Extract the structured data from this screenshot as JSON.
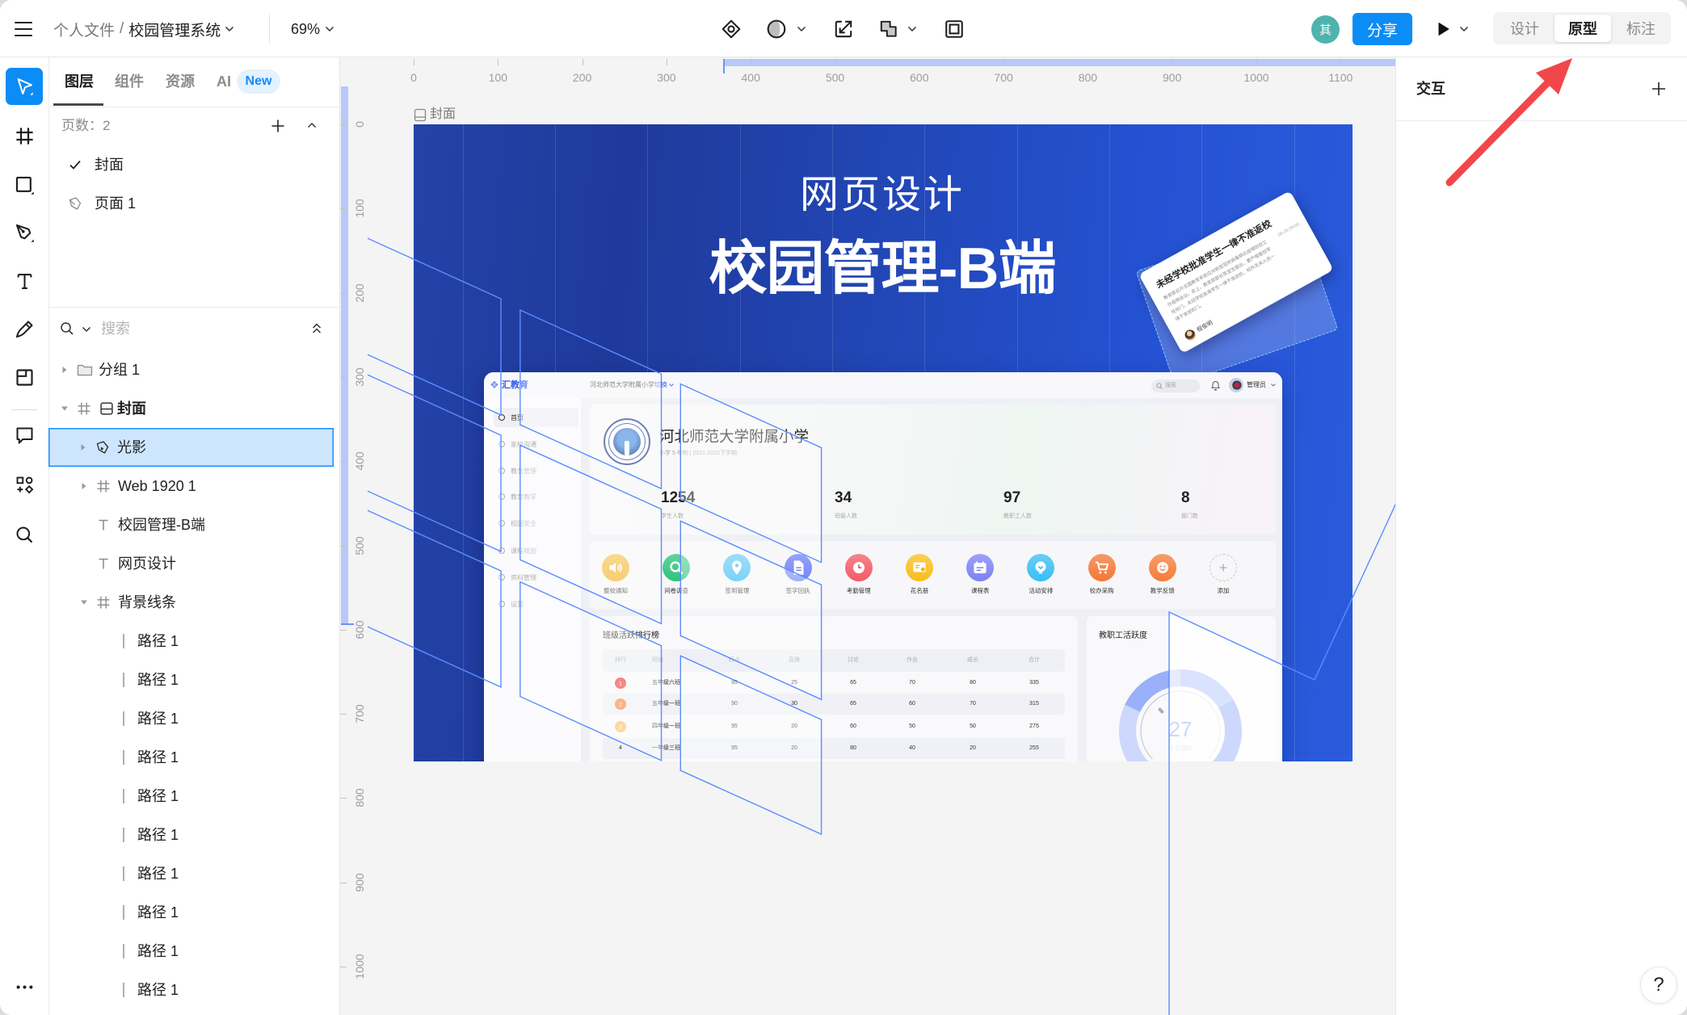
{
  "topbar": {
    "breadcrumb_parent": "个人文件",
    "breadcrumb_sep": "/",
    "file_name": "校园管理系统",
    "zoom": "69%",
    "center_tools": [
      "component-icon",
      "theme-icon",
      "export-icon",
      "boolean-icon",
      "frame-icon"
    ],
    "collaborator_initial": "其",
    "share_label": "分享",
    "modes": [
      {
        "label": "设计",
        "active": false
      },
      {
        "label": "原型",
        "active": true
      },
      {
        "label": "标注",
        "active": false
      }
    ]
  },
  "toolbar": {
    "tools": [
      "move",
      "frame",
      "rectangle",
      "pen",
      "text",
      "pencil",
      "section",
      "comment",
      "plugins",
      "search",
      "more"
    ],
    "active": "move"
  },
  "layers_panel": {
    "tabs": [
      {
        "label": "图层",
        "active": true
      },
      {
        "label": "组件",
        "active": false
      },
      {
        "label": "资源",
        "active": false
      },
      {
        "label": "AI",
        "active": false,
        "badge": "New"
      }
    ],
    "pages_title": "页数：2",
    "pages": [
      {
        "label": "封面",
        "current": true
      },
      {
        "label": "页面 1",
        "current": false
      }
    ],
    "search_placeholder": "搜索",
    "tree": [
      {
        "label": "分组 1",
        "type": "group",
        "depth": 0,
        "expand": "collapsed"
      },
      {
        "label": "封面",
        "type": "frame-page",
        "depth": 0,
        "expand": "expanded",
        "bold": true
      },
      {
        "label": "光影",
        "type": "vector",
        "depth": 1,
        "expand": "collapsed",
        "selected": true
      },
      {
        "label": "Web 1920 1",
        "type": "frame",
        "depth": 1,
        "expand": "collapsed"
      },
      {
        "label": "校园管理-B端",
        "type": "text",
        "depth": 1
      },
      {
        "label": "网页设计",
        "type": "text",
        "depth": 1
      },
      {
        "label": "背景线条",
        "type": "frame",
        "depth": 1,
        "expand": "expanded"
      },
      {
        "label": "路径 1",
        "type": "line",
        "depth": 2
      },
      {
        "label": "路径 1",
        "type": "line",
        "depth": 2
      },
      {
        "label": "路径 1",
        "type": "line",
        "depth": 2
      },
      {
        "label": "路径 1",
        "type": "line",
        "depth": 2
      },
      {
        "label": "路径 1",
        "type": "line",
        "depth": 2
      },
      {
        "label": "路径 1",
        "type": "line",
        "depth": 2
      },
      {
        "label": "路径 1",
        "type": "line",
        "depth": 2
      },
      {
        "label": "路径 1",
        "type": "line",
        "depth": 2
      },
      {
        "label": "路径 1",
        "type": "line",
        "depth": 2
      },
      {
        "label": "路径 1",
        "type": "line",
        "depth": 2
      }
    ]
  },
  "canvas": {
    "ruler_x": [
      "0",
      "100",
      "200",
      "300",
      "400",
      "500",
      "600",
      "700",
      "800",
      "900",
      "1000",
      "1100"
    ],
    "ruler_y": [
      "0",
      "100",
      "200",
      "300",
      "400",
      "500",
      "600",
      "700",
      "800",
      "900",
      "1000"
    ],
    "frame_label": "封面"
  },
  "artboard": {
    "subtitle": "网页设计",
    "title": "校园管理-B端",
    "notice_card": {
      "title": "未经学校批准学生一律不准返校",
      "body": "教育部召开全国教育系统应对新型冠状病毒肺炎疫情防控工作视频会议。会上，教育部部长陈宝生提出，要严格管控学校校门，未经学校批准学生一律不准返校，校外无关人员一律不准进校门。",
      "date": "08-26 09:00",
      "author": "程俊明"
    },
    "dashboard": {
      "logo": "汇教育",
      "school_selector": "河北师范大学附属小学",
      "switch_label": "切换",
      "search_placeholder": "搜索",
      "user_name": "管理员",
      "menu": [
        {
          "label": "首页",
          "active": true
        },
        {
          "label": "家校沟通",
          "active": false
        },
        {
          "label": "教务管理",
          "active": false
        },
        {
          "label": "教育教学",
          "active": false
        },
        {
          "label": "校园安全",
          "active": false
        },
        {
          "label": "课程规划",
          "active": false
        },
        {
          "label": "资料管理",
          "active": false
        },
        {
          "label": "设置",
          "active": false
        }
      ],
      "school": {
        "name": "河北师范大学附属小学",
        "meta": "小学 5 年制 | 2021-2022下学期"
      },
      "stats": [
        {
          "value": "1254",
          "label": "学生人数"
        },
        {
          "value": "34",
          "label": "班级人数"
        },
        {
          "value": "97",
          "label": "教职工人数"
        },
        {
          "value": "8",
          "label": "部门数"
        }
      ],
      "quick_actions": [
        {
          "label": "整校通知",
          "icon": "speaker",
          "color": "#F3B223"
        },
        {
          "label": "问卷调查",
          "icon": "search",
          "color": "#2CC47C"
        },
        {
          "label": "签到管理",
          "icon": "location",
          "color": "#36BCF4"
        },
        {
          "label": "签字回执",
          "icon": "document",
          "color": "#7384F5"
        },
        {
          "label": "考勤管理",
          "icon": "clock",
          "color": "#F25B66"
        },
        {
          "label": "花名册",
          "icon": "certificate",
          "color": "#F7BE1B"
        },
        {
          "label": "课程表",
          "icon": "calendar",
          "color": "#7D81F4"
        },
        {
          "label": "活动安排",
          "icon": "chat",
          "color": "#38BEF3"
        },
        {
          "label": "校办采购",
          "icon": "cart",
          "color": "#F47735"
        },
        {
          "label": "教学反馈",
          "icon": "smile",
          "color": "#F57C38"
        },
        {
          "label": "添加",
          "icon": "plus",
          "color": null
        }
      ],
      "ranking": {
        "title": "班级活跃排行榜",
        "columns": [
          "排行",
          "班级",
          "打卡",
          "直播",
          "讨论",
          "作业",
          "成长",
          "合计"
        ],
        "rows": [
          [
            "1",
            "五年级六班",
            "95",
            "25",
            "65",
            "70",
            "80",
            "335"
          ],
          [
            "2",
            "五年级一班",
            "90",
            "30",
            "65",
            "60",
            "70",
            "315"
          ],
          [
            "3",
            "四年级一班",
            "95",
            "20",
            "60",
            "50",
            "50",
            "275"
          ],
          [
            "4",
            "一年级三班",
            "95",
            "20",
            "80",
            "40",
            "20",
            "255"
          ]
        ],
        "rank_colors": [
          "#F2464B",
          "#FA8A45",
          "#FDC36A"
        ]
      },
      "staff_activity": {
        "title": "教职工活跃度",
        "value": "27",
        "caption": "今日活跃",
        "segments": [
          {
            "fraction": 0.26,
            "color": "#CCD7FB"
          },
          {
            "fraction": 0.24,
            "color": "#9AB0F9"
          },
          {
            "fraction": 0.22,
            "color": "#6A8EF7"
          },
          {
            "fraction": 0.28,
            "color": "#3565F2"
          }
        ]
      }
    }
  },
  "right_panel": {
    "title": "交互",
    "help_label": "?"
  },
  "annotation": {
    "shape": "arrow",
    "color": "#F2474A",
    "points_to": "原型"
  },
  "colors": {
    "accent": "#0C8CF5",
    "selection_bg": "#CDE6FD",
    "selection_border": "#1A8CFF",
    "canvas_bg": "#F4F4F4",
    "guide_line": "#5B8CFF",
    "avatar_bg": "#4FB3AD"
  }
}
